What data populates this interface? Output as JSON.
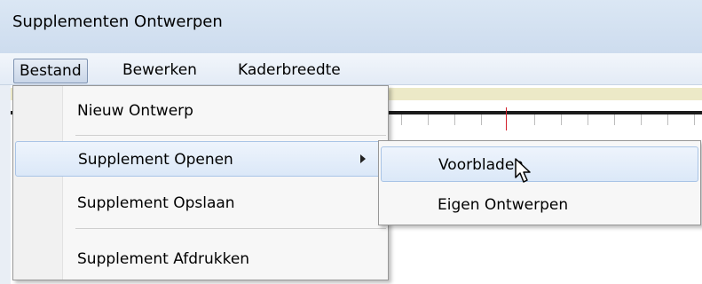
{
  "window": {
    "title": "Supplementen Ontwerpen"
  },
  "menubar": {
    "items": [
      {
        "label": "Bestand",
        "active": true
      },
      {
        "label": "Bewerken"
      },
      {
        "label": "Kaderbreedte"
      }
    ]
  },
  "file_menu": {
    "items": [
      {
        "label": "Nieuw Ontwerp"
      },
      {
        "label": "Supplement Openen",
        "has_submenu": true,
        "highlighted": true
      },
      {
        "label": "Supplement Opslaan"
      },
      {
        "label": "Supplement Afdrukken"
      }
    ]
  },
  "open_submenu": {
    "items": [
      {
        "label": "Voorbladen",
        "highlighted": true
      },
      {
        "label": "Eigen Ontwerpen"
      }
    ]
  },
  "colors": {
    "highlight": "#dbe8f8",
    "ruler_marker": "#d21f2a"
  },
  "icons": {
    "cursor": "arrow-pointer-icon",
    "submenu": "chevron-right-icon"
  }
}
